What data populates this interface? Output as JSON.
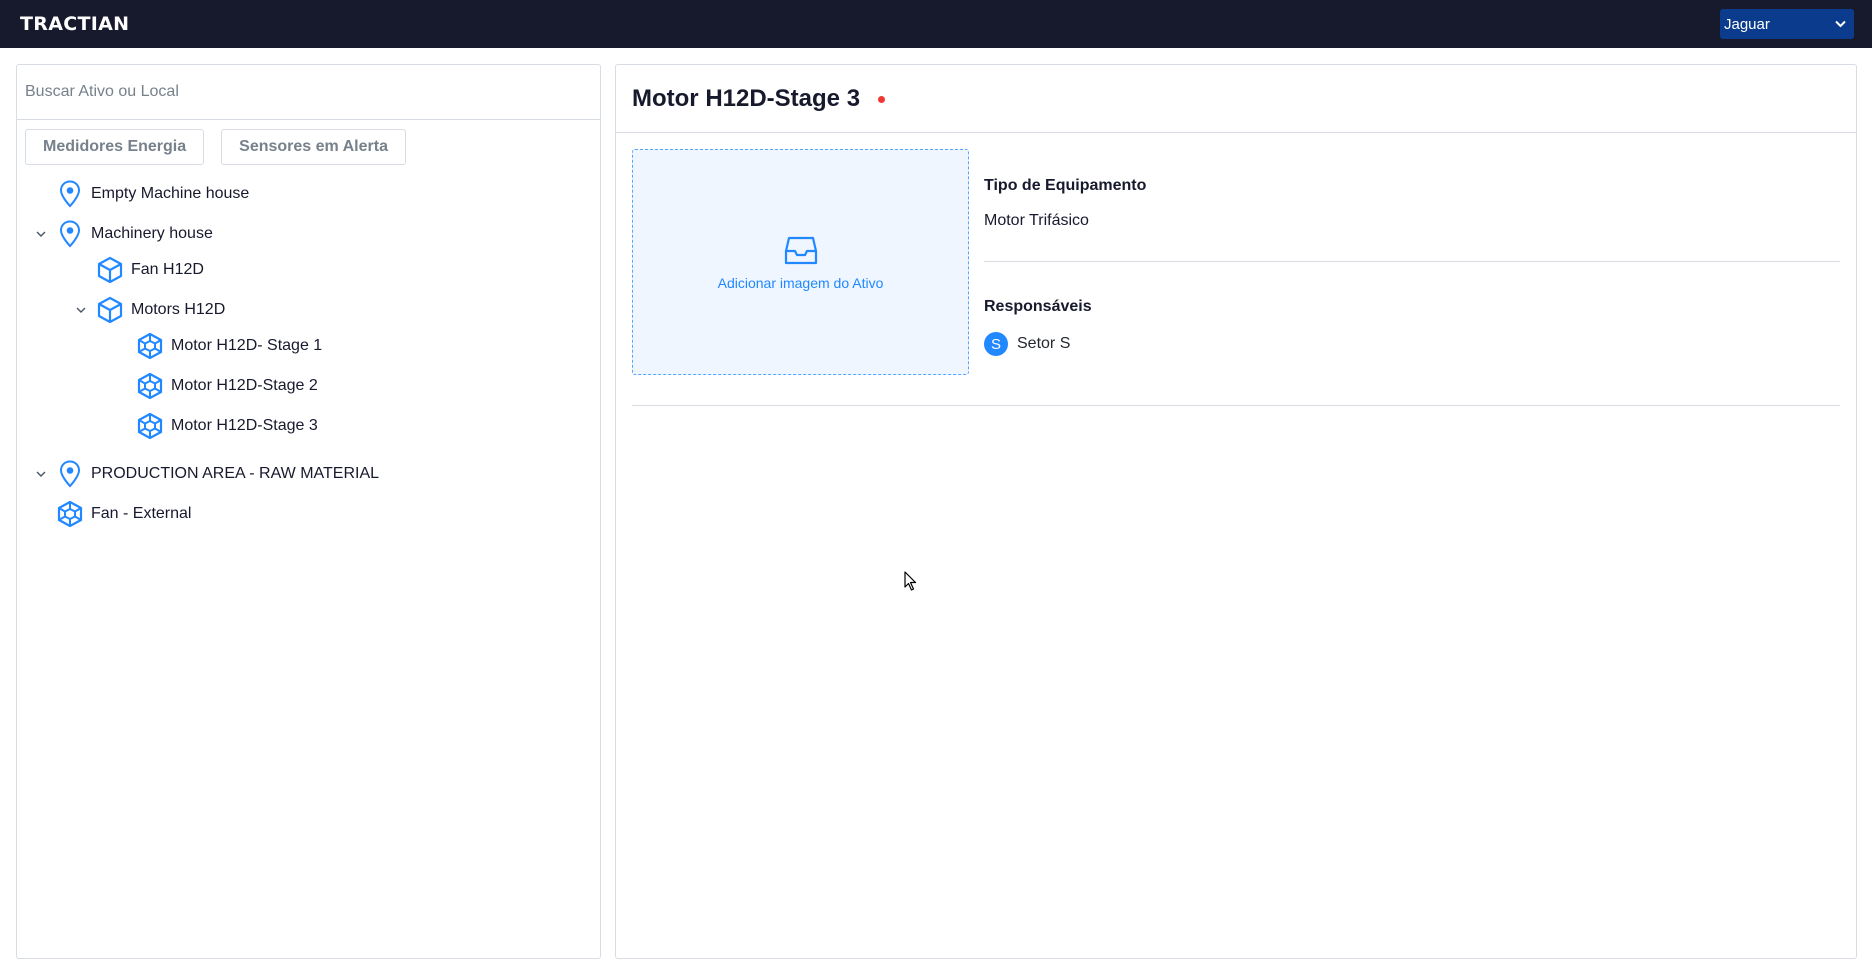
{
  "header": {
    "logo": "TRACTIAN",
    "company_select": {
      "value": "Jaguar",
      "chevron": "chevron-down-icon"
    }
  },
  "sidebar": {
    "search": {
      "placeholder": "Buscar Ativo ou Local",
      "value": ""
    },
    "filters": [
      "Medidores Energia",
      "Sensores em Alerta"
    ],
    "tree": [
      {
        "label": "Empty Machine house",
        "icon": "location-pin-icon",
        "expanded": null
      },
      {
        "label": "Machinery house",
        "icon": "location-pin-icon",
        "expanded": true
      },
      {
        "label": "Fan H12D",
        "icon": "asset-cube-icon",
        "expanded": null
      },
      {
        "label": "Motors H12D",
        "icon": "asset-cube-icon",
        "expanded": true
      },
      {
        "label": "Motor H12D- Stage 1",
        "icon": "component-icon",
        "expanded": null
      },
      {
        "label": "Motor H12D-Stage 2",
        "icon": "component-icon",
        "expanded": null
      },
      {
        "label": "Motor H12D-Stage 3",
        "icon": "component-icon",
        "expanded": null
      },
      {
        "label": "PRODUCTION AREA - RAW MATERIAL",
        "icon": "location-pin-icon",
        "expanded": true
      },
      {
        "label": "Fan - External",
        "icon": "component-icon",
        "expanded": null
      }
    ]
  },
  "detail": {
    "title": "Motor H12D-Stage 3",
    "status_color": "#ED3833",
    "image_upload_label": "Adicionar imagem do Ativo",
    "equipment_type": {
      "heading": "Tipo de Equipamento",
      "value": "Motor Trifásico"
    },
    "responsibles": {
      "heading": "Responsáveis",
      "items": [
        {
          "initial": "S",
          "name": "Setor S"
        }
      ]
    }
  },
  "colors": {
    "header_bg": "#17192D",
    "accent": "#2188FF",
    "select_bg": "#0B3B8C",
    "border": "#D8DDE4"
  }
}
